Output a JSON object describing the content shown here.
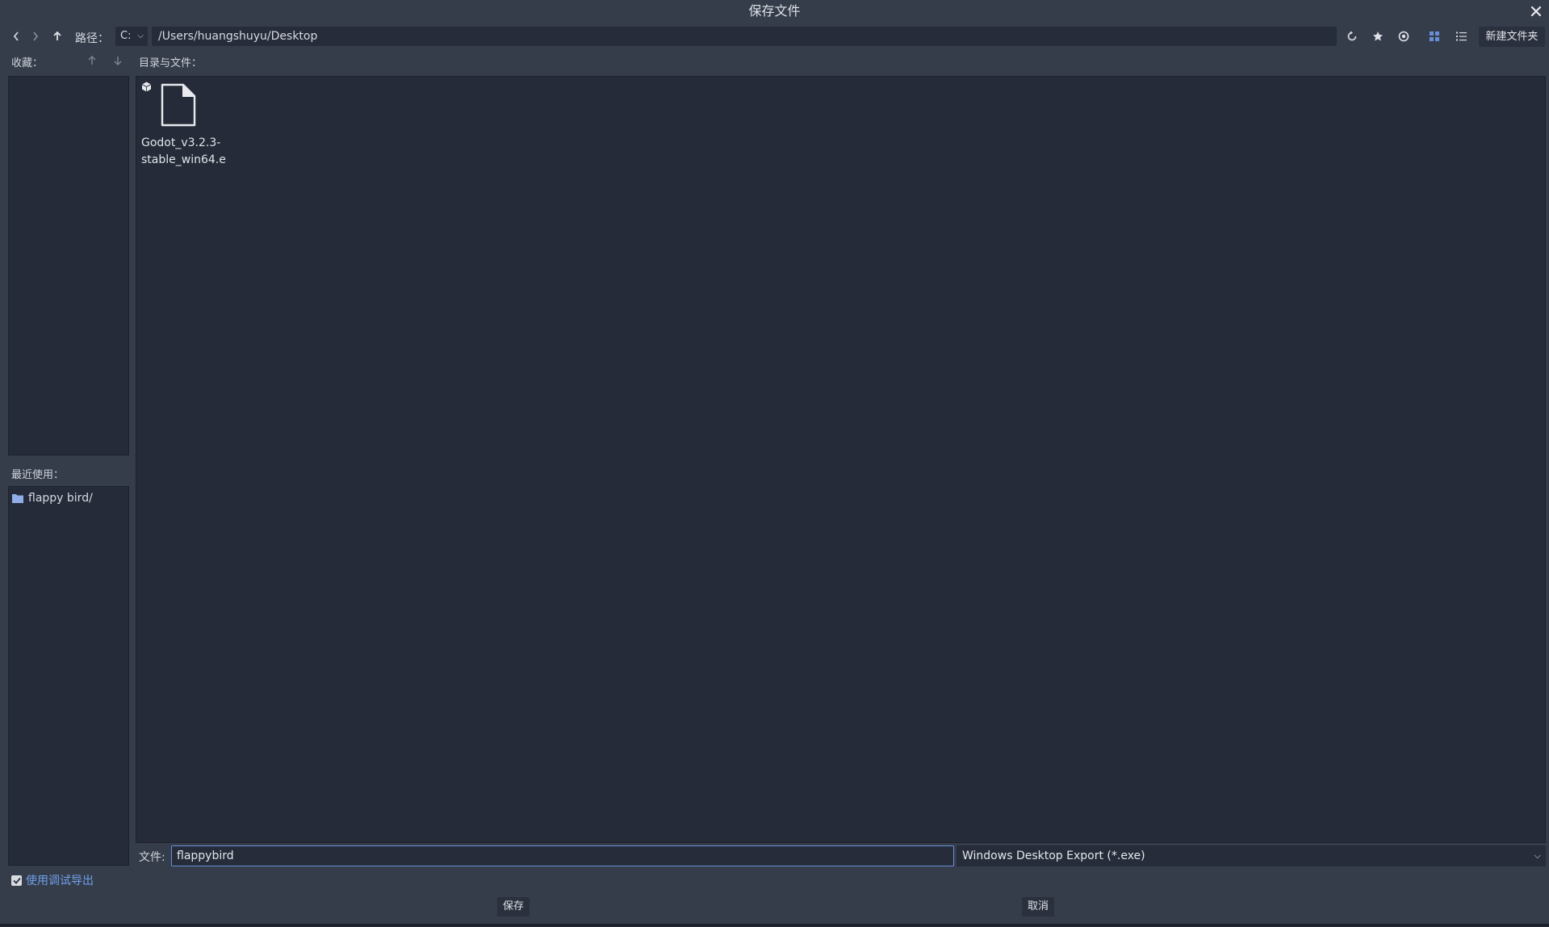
{
  "dialog": {
    "title": "保存文件"
  },
  "toolbar": {
    "path_label": "路径：",
    "drive": "C:",
    "path_value": "/Users/huangshuyu/Desktop",
    "new_folder_label": "新建文件夹"
  },
  "favorites": {
    "label": "收藏："
  },
  "recent": {
    "label": "最近使用：",
    "items": [
      {
        "label": "flappy bird/"
      }
    ]
  },
  "files": {
    "label": "目录与文件：",
    "items": [
      {
        "name_line1": "Godot_v3.2.3-",
        "name_line2": "stable_win64.e"
      }
    ]
  },
  "footer": {
    "file_label": "文件:",
    "filename_value": "flappybird",
    "filter_value": "Windows Desktop Export (*.exe)",
    "debug_export_label": "使用调试导出",
    "debug_export_checked": true,
    "save_label": "保存",
    "cancel_label": "取消"
  },
  "colors": {
    "background": "#363d4a",
    "panel": "#252b38",
    "accent": "#6890d8",
    "link": "#6ea0ec"
  },
  "icons": [
    "close-icon",
    "back-arrow-icon",
    "forward-arrow-icon",
    "up-arrow-icon",
    "refresh-icon",
    "favorite-star-icon",
    "show-hidden-eye-icon",
    "grid-view-icon",
    "list-view-icon",
    "move-up-icon",
    "move-down-icon",
    "folder-icon",
    "file-icon",
    "package-icon",
    "checkmark-icon",
    "chevron-down-icon"
  ]
}
